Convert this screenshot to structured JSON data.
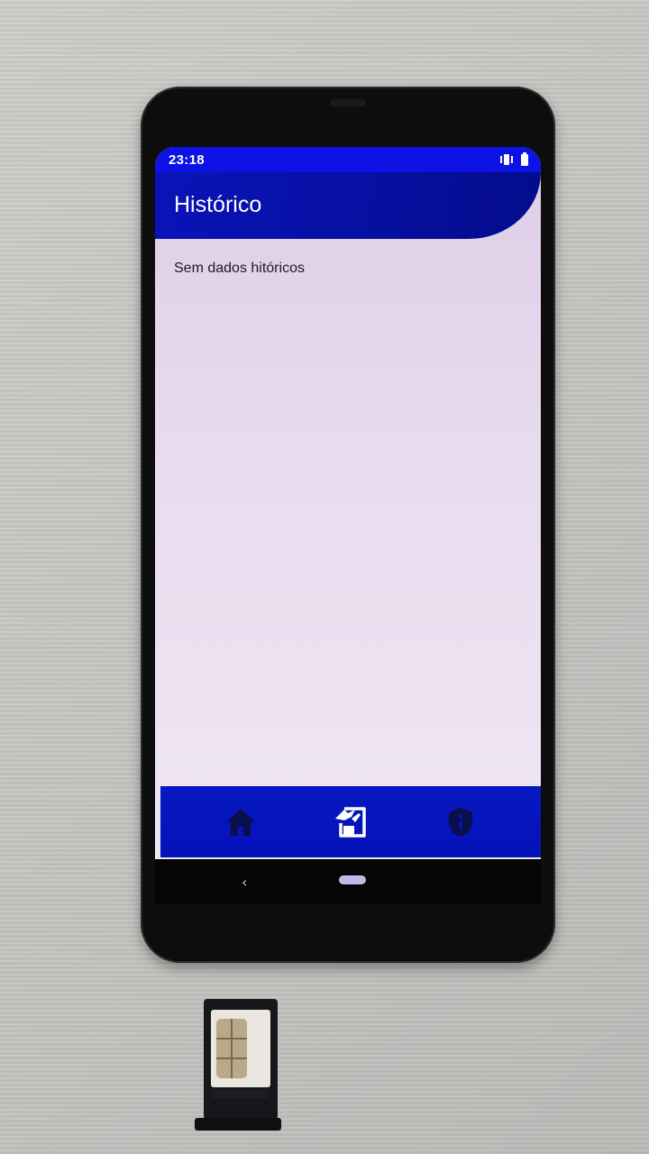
{
  "status_bar": {
    "time": "23:18",
    "icons": [
      "vibrate-icon",
      "battery-icon"
    ]
  },
  "app_bar": {
    "title": "Histórico"
  },
  "content": {
    "empty_message": "Sem dados hitóricos"
  },
  "bottom_nav": {
    "items": [
      {
        "icon": "home-icon",
        "active": false
      },
      {
        "icon": "sim-card-history-icon",
        "active": true
      },
      {
        "icon": "shield-info-icon",
        "active": false
      }
    ]
  },
  "system_nav": {
    "back_glyph": "‹"
  },
  "colors": {
    "primary": "#0413b8",
    "status_bar": "#0c12e4",
    "screen_bg": "#e8dcef",
    "nav_icon_inactive": "#0a0f4a",
    "nav_icon_active": "#ffffff"
  }
}
